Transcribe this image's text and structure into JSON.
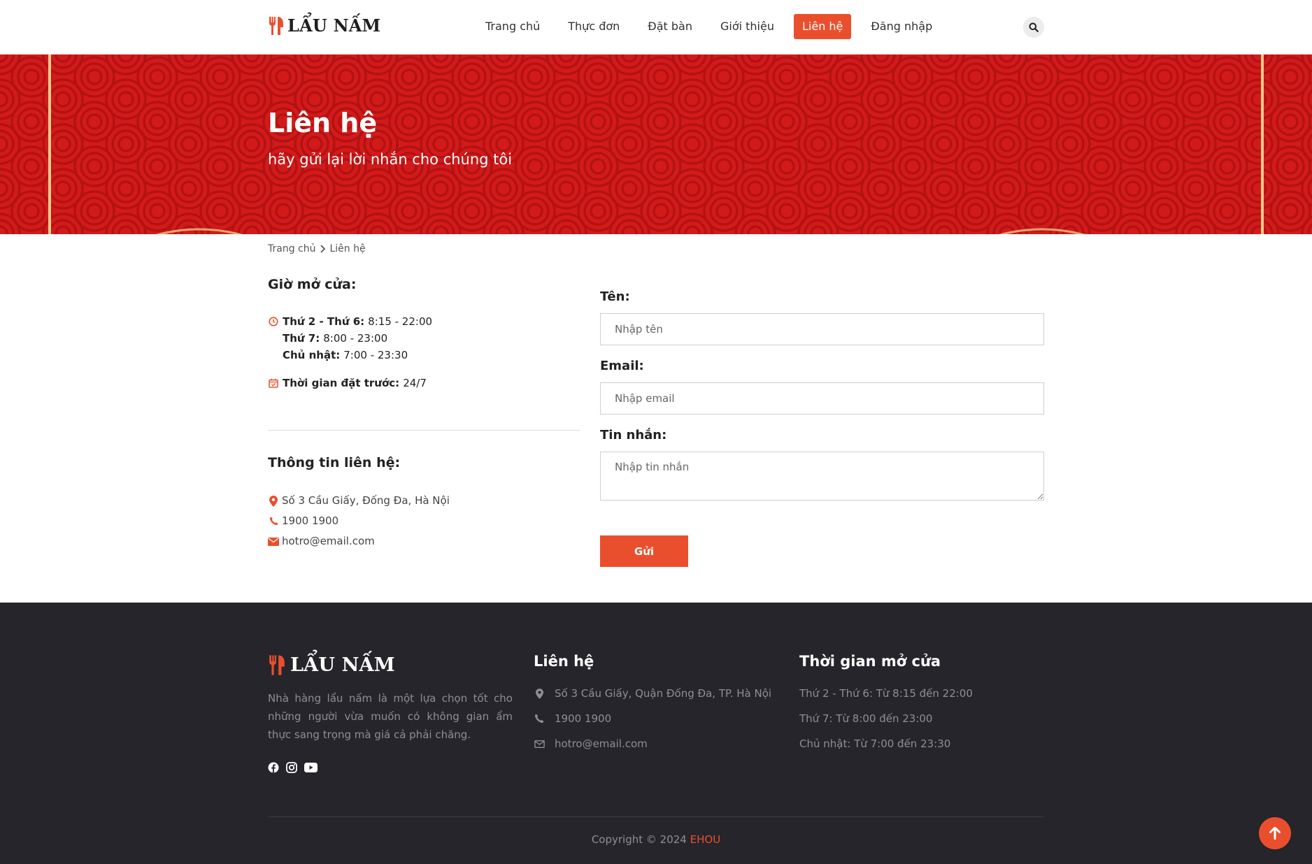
{
  "brand": {
    "name": "LẨU NẤM",
    "accent_color": "#ea4f2d",
    "icon": "fork-knife-icon"
  },
  "nav": {
    "items": [
      {
        "label": "Trang chủ",
        "active": false
      },
      {
        "label": "Thực đơn",
        "active": false
      },
      {
        "label": "Đặt bàn",
        "active": false
      },
      {
        "label": "Giới thiệu",
        "active": false
      },
      {
        "label": "Liên hệ",
        "active": true
      },
      {
        "label": "Đăng nhập",
        "active": false
      }
    ],
    "search_icon": "search-icon"
  },
  "hero": {
    "title": "Liên hệ",
    "subtitle": "hãy gửi lại lời nhắn cho chúng tôi",
    "background_color": "#d31a1a"
  },
  "breadcrumb": {
    "home": "Trang chủ",
    "current": "Liên hệ"
  },
  "hours": {
    "title": "Giờ mở cửa:",
    "rows": [
      {
        "day": "Thứ 2 - Thứ 6:",
        "time": "8:15 - 22:00"
      },
      {
        "day": "Thứ 7:",
        "time": "8:00 - 23:00"
      },
      {
        "day": "Chủ nhật:",
        "time": "7:00 - 23:30"
      }
    ],
    "advance_label": "Thời gian đặt trước:",
    "advance_value": "24/7"
  },
  "contact": {
    "title": "Thông tin liên hệ:",
    "address": "Số 3 Cầu Giấy, Đống Đa, Hà Nội",
    "phone": "1900 1900",
    "email": "hotro@email.com"
  },
  "form": {
    "name_label": "Tên:",
    "name_placeholder": "Nhập tên",
    "email_label": "Email:",
    "email_placeholder": "Nhập email",
    "message_label": "Tin nhắn:",
    "message_placeholder": "Nhập tin nhắn",
    "submit_label": "Gửi"
  },
  "footer": {
    "brand": "LẨU NẤM",
    "description": "Nhà hàng lẩu nấm là một lựa chọn tốt cho những người vừa muốn có không gian ẩm thực sang trọng mà giá cả phải chăng.",
    "social": [
      "facebook-icon",
      "instagram-icon",
      "youtube-icon"
    ],
    "contact_title": "Liên hệ",
    "address": "Số 3 Cầu Giấy, Quận Đống Đa, TP. Hà Nội",
    "phone": "1900 1900",
    "email": "hotro@email.com",
    "hours_title": "Thời gian mở cửa",
    "hours": [
      "Thứ 2 - Thứ 6: Từ 8:15 đến 22:00",
      "Thứ 7: Từ 8:00 đến 23:00",
      "Chủ nhật: Từ 7:00 đến 23:30"
    ],
    "copyright_text": "Copyright © 2024",
    "copyright_brand": "EHOU",
    "background_color": "#25252b"
  }
}
